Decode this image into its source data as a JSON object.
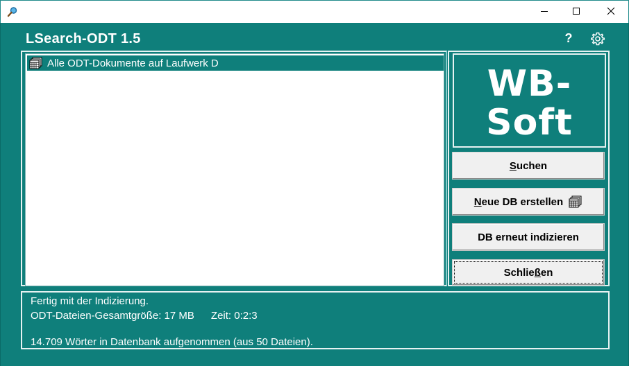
{
  "window": {
    "icon": "magnifier-icon",
    "controls": [
      "minimize-icon",
      "maximize-icon",
      "close-icon"
    ]
  },
  "app": {
    "title": "LSearch-ODT 1.5",
    "help_label": "?",
    "settings_icon": "gear-icon"
  },
  "tree": {
    "items": [
      {
        "label": "Alle ODT-Dokumente auf Laufwerk D",
        "icon": "database-icon",
        "selected": true
      }
    ]
  },
  "logo": {
    "line1": "WB-",
    "line2": "Soft"
  },
  "buttons": {
    "search": {
      "pre": "",
      "accel": "S",
      "post": "uchen"
    },
    "new_db": {
      "pre": "",
      "accel": "N",
      "post": "eue DB erstellen",
      "icon": "database-icon"
    },
    "reindex": {
      "label": "DB erneut indizieren"
    },
    "close": {
      "pre": "Schlie",
      "accel": "ß",
      "post": "en"
    }
  },
  "status": {
    "line1": "Fertig mit der Indizierung.",
    "size_text": "ODT-Dateien-Gesamtgröße: 17 MB",
    "time_text": "Zeit: 0:2:3",
    "line3": "14.709 Wörter in Datenbank aufgenommen (aus 50 Dateien)."
  },
  "colors": {
    "background": "#0f7f7b",
    "selection": "#0f7f7b",
    "text_light": "#ffffff",
    "button_face": "#f0f0f0"
  }
}
